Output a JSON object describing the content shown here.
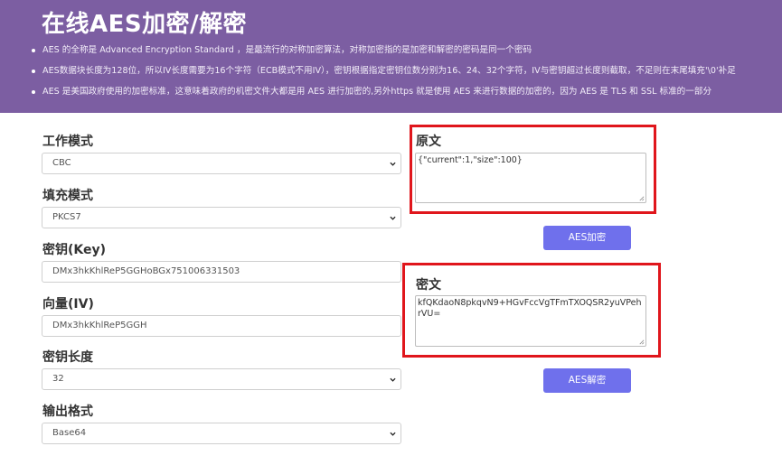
{
  "header": {
    "title": "在线AES加密/解密",
    "bullets": [
      "AES 的全称是 Advanced Encryption Standard ，是最流行的对称加密算法，对称加密指的是加密和解密的密码是同一个密码",
      "AES数据块长度为128位，所以IV长度需要为16个字符（ECB模式不用IV），密钥根据指定密钥位数分别为16、24、32个字符，IV与密钥超过长度则截取，不足则在末尾填充'\\0'补足",
      "AES 是美国政府使用的加密标准，这意味着政府的机密文件大都是用 AES 进行加密的,另外https 就是使用 AES 来进行数据的加密的，因为 AES 是 TLS 和 SSL 标准的一部分"
    ]
  },
  "form": {
    "mode_label": "工作模式",
    "mode_value": "CBC",
    "padding_label": "填充模式",
    "padding_value": "PKCS7",
    "key_label": "密钥(Key)",
    "key_value": "DMx3hkKhlReP5GGHoBGx751006331503",
    "iv_label": "向量(IV)",
    "iv_value": "DMx3hkKhlReP5GGH",
    "keylen_label": "密钥长度",
    "keylen_value": "32",
    "output_label": "输出格式",
    "output_value": "Base64"
  },
  "plain": {
    "title": "原文",
    "value": "{\"current\":1,\"size\":100}"
  },
  "encrypt_button": "AES加密",
  "cipher": {
    "title": "密文",
    "value": "kfQKdaoN8pkqvN9+HGvFccVgTFmTXOQSR2yuVPehrVU="
  },
  "decrypt_button": "AES解密",
  "colors": {
    "header_bg": "#7c5ea2",
    "button_bg": "#6f70ec",
    "highlight_border": "#e0161c"
  }
}
